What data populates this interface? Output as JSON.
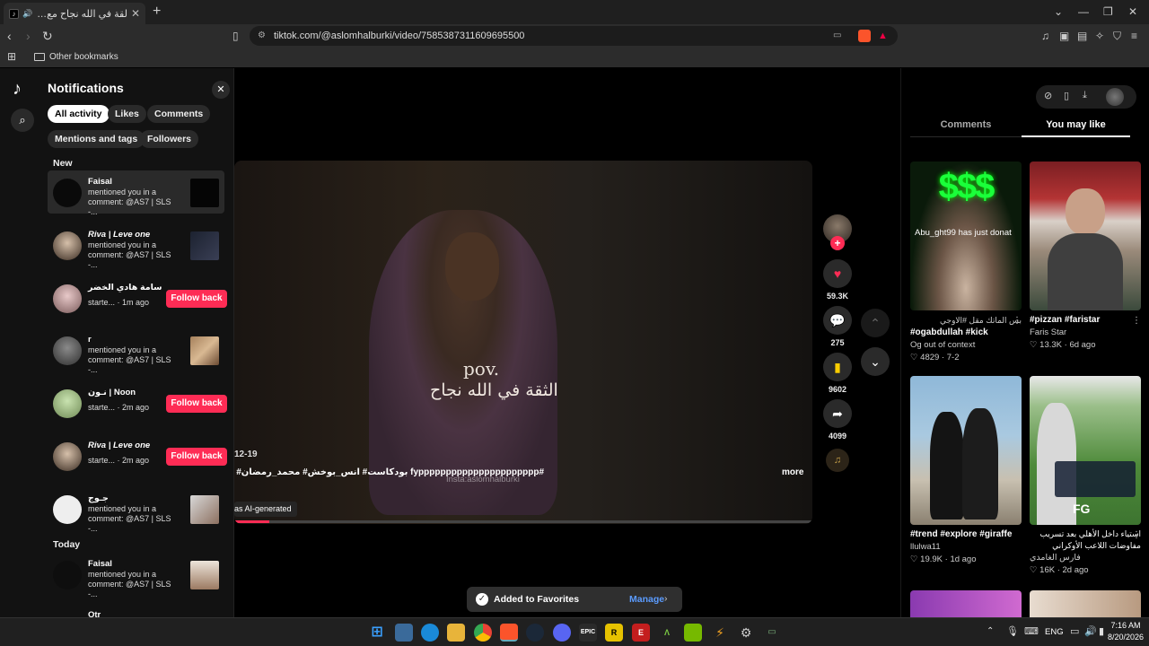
{
  "browser": {
    "tab_title": "لقة في الله نجاح مع محمد رمضان",
    "url": "tiktok.com/@aslomhalburki/video/7585387311609695500",
    "bookmark_folder": "Other bookmarks"
  },
  "notifications": {
    "title": "Notifications",
    "filters": [
      "All activity",
      "Likes",
      "Comments",
      "Mentions and tags",
      "Followers"
    ],
    "section_new": "New",
    "section_today": "Today",
    "items": [
      {
        "name": "Faisal",
        "text": "mentioned you in a comment: @AS7 | SLS -...",
        "thumb_color": "#111"
      },
      {
        "name": "Riva | Leve one",
        "text": "mentioned you in a comment: @AS7 | SLS -...",
        "thumb_color": "#2a2f3a"
      },
      {
        "name": "سامة هادي الخضر",
        "text": "starte... · 1m ago",
        "button": "Follow back"
      },
      {
        "name": "r",
        "text": "mentioned you in a comment: @AS7 | SLS -...",
        "thumb_color": "#8a6b4a"
      },
      {
        "name": "نـون | Noon",
        "text": "starte... · 2m ago",
        "button": "Follow back"
      },
      {
        "name": "Riva | Leve one",
        "text": "starte... · 2m ago",
        "button": "Follow back"
      },
      {
        "name": "جـوج",
        "text": "mentioned you in a comment: @AS7 | SLS -...",
        "thumb_color": "#c9c9c9"
      },
      {
        "name": "Faisal",
        "text": "mentioned you in a comment: @AS7 | SLS -...",
        "thumb_color": "#b99a80"
      },
      {
        "name": "Otr",
        "text": ""
      }
    ]
  },
  "video": {
    "overlay_pov": "pov.",
    "overlay_arabic": "الثقة في الله نجاح",
    "watermark": "Insta:aslomhalburki",
    "date": "12-19",
    "caption": "#fypppppppppppppppppppppp بودكاست# انس_بوخش# محمد_رمضان# ♥",
    "more": "more",
    "ai_label": "as AI-generated",
    "likes": "59.3K",
    "comments": "275",
    "saves": "9602",
    "shares": "4099"
  },
  "right_panel": {
    "tabs": [
      "Comments",
      "You may like"
    ],
    "cards": [
      {
        "caption_ar": "بس الماتك مقل #الاوجي",
        "title": "#ogabdullah #kick",
        "author": "Og out of context",
        "likes": "4829",
        "date": "7-2",
        "overlay": "Abu_ght99 has just donat"
      },
      {
        "caption_ar": "",
        "title": "#pizzan #faristar",
        "author": "Faris Star",
        "likes": "13.3K",
        "date": "6d ago",
        "overlay": ""
      },
      {
        "caption_ar": "",
        "title": "#trend #explore #giraffe",
        "author": "llulwa11",
        "likes": "19.9K",
        "date": "1d ago",
        "overlay": ""
      },
      {
        "caption_ar": "استياء داخل الأهلي بعد تسريب مفاوضات اللاعب الأوكراني أرتيم...",
        "title": "",
        "author": "فارس الغامدي",
        "likes": "16K",
        "date": "2d ago",
        "overlay": "FG"
      }
    ]
  },
  "toast": {
    "text": "Added to Favorites",
    "action": "Manage"
  },
  "taskbar": {
    "lang": "ENG",
    "time": "7:16 AM",
    "date": "8/20/2026"
  }
}
